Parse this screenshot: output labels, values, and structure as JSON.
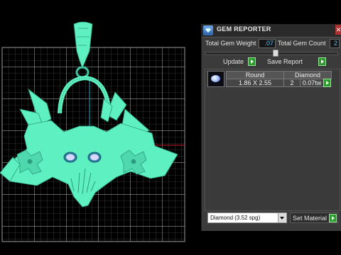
{
  "panel": {
    "title": "GEM REPORTER",
    "close_icon": "close-icon",
    "total_gem_weight_label": "Total Gem Weight",
    "total_gem_weight_value": ".07",
    "total_gem_count_label": "Total Gem Count",
    "total_gem_count_value": "2",
    "slider_level": 0.55,
    "update_label": "Update",
    "save_report_label": "Save Report",
    "table": {
      "columns": [
        "Round",
        "Diamond"
      ],
      "rows": [
        {
          "size": "1.86 X 2.55",
          "count": "2",
          "weight": "0.07tw"
        }
      ]
    },
    "material_select": "Diamond    (3.52 spg)",
    "set_material_label": "Set Material"
  },
  "colors": {
    "model": "#5ef0c0",
    "grid": "#b4b4b4",
    "accent_value": "#56c8ff",
    "go_button": "#2c9a2c"
  }
}
